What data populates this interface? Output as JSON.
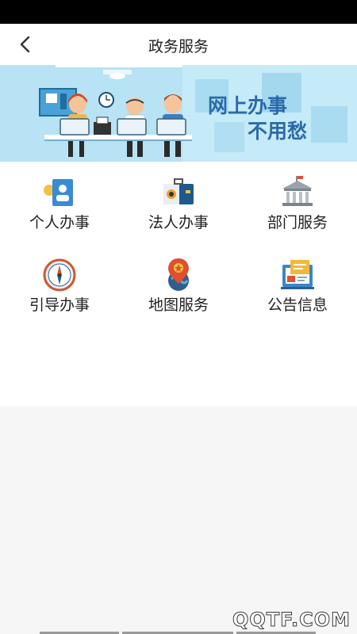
{
  "header": {
    "title": "政务服务"
  },
  "banner": {
    "slogan_line1": "网上办事",
    "slogan_line2": "不用愁"
  },
  "services": [
    {
      "label": "个人办事",
      "icon": "id-card-icon"
    },
    {
      "label": "法人办事",
      "icon": "briefcase-icon"
    },
    {
      "label": "部门服务",
      "icon": "government-building-icon"
    },
    {
      "label": "引导办事",
      "icon": "compass-icon"
    },
    {
      "label": "地图服务",
      "icon": "map-pin-icon"
    },
    {
      "label": "公告信息",
      "icon": "notice-board-icon"
    }
  ],
  "watermark": "QQTF.COM",
  "colors": {
    "banner_bg": "#b7e3f4",
    "slogan": "#2a6aa8",
    "nav_bg": "#ffffff",
    "page_bg": "#f6f6f6"
  }
}
